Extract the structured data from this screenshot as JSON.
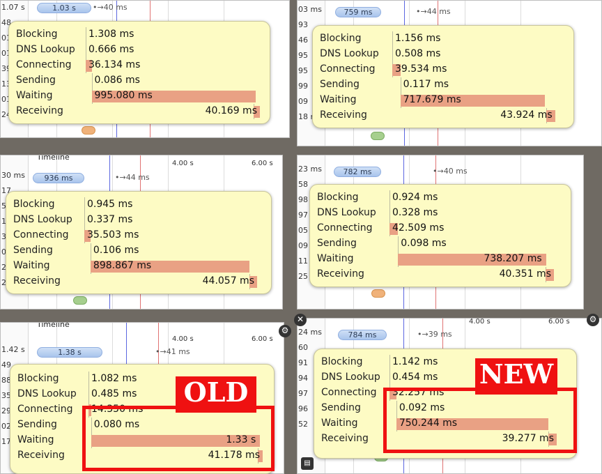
{
  "colors": {
    "tooltip_bg": "#fdfbc4",
    "bar": "#e9a184",
    "annotation": "#ef1111",
    "blue_marker": "#5c67e0",
    "red_marker": "#e07373"
  },
  "icons": [
    "close-icon",
    "gear-icon",
    "toolbar-icon"
  ],
  "panels": [
    {
      "row_labels": [
        "1.07 s",
        "48",
        "01",
        "01",
        "39",
        "13",
        "01",
        "24 ms"
      ],
      "pill": "1.03 s",
      "arrow": "40 ms",
      "ticks": [],
      "timeline": "",
      "rows": [
        {
          "label": "Blocking",
          "value": "1.308 ms",
          "bar": 0.0,
          "start": 0.0
        },
        {
          "label": "DNS Lookup",
          "value": "0.666 ms",
          "bar": 0.0,
          "start": 0.0
        },
        {
          "label": "Connecting",
          "value": "36.134 ms",
          "bar": 0.034,
          "start": 0.0
        },
        {
          "label": "Sending",
          "value": "0.086 ms",
          "bar": 0.0,
          "start": 0.034
        },
        {
          "label": "Waiting",
          "value": "995.080 ms",
          "bar": 0.94,
          "start": 0.034
        },
        {
          "label": "Receiving",
          "value": "40.169 ms",
          "bar": 0.038,
          "start": 0.962
        }
      ]
    },
    {
      "row_labels": [
        "03 ms",
        "93",
        "46",
        "95",
        "95",
        "99",
        "09",
        "18 ms"
      ],
      "pill": "759 ms",
      "arrow": "44 ms",
      "ticks": [],
      "timeline": "",
      "rows": [
        {
          "label": "Blocking",
          "value": "1.156 ms",
          "bar": 0.0,
          "start": 0.0
        },
        {
          "label": "DNS Lookup",
          "value": "0.508 ms",
          "bar": 0.0,
          "start": 0.0
        },
        {
          "label": "Connecting",
          "value": "39.534 ms",
          "bar": 0.049,
          "start": 0.0
        },
        {
          "label": "Sending",
          "value": "0.117 ms",
          "bar": 0.0,
          "start": 0.049
        },
        {
          "label": "Waiting",
          "value": "717.679 ms",
          "bar": 0.88,
          "start": 0.049
        },
        {
          "label": "Receiving",
          "value": "43.924 ms",
          "bar": 0.055,
          "start": 0.935
        }
      ]
    },
    {
      "row_labels": [
        "30 ms",
        "17",
        "56",
        "14",
        "34",
        "06",
        "24",
        "23 ms"
      ],
      "pill": "936 ms",
      "arrow": "44 ms",
      "ticks": [
        "4.00 s",
        "6.00 s"
      ],
      "timeline": "Timeline",
      "rows": [
        {
          "label": "Blocking",
          "value": "0.945 ms",
          "bar": 0.0,
          "start": 0.0
        },
        {
          "label": "DNS Lookup",
          "value": "0.337 ms",
          "bar": 0.0,
          "start": 0.0
        },
        {
          "label": "Connecting",
          "value": "35.503 ms",
          "bar": 0.036,
          "start": 0.0
        },
        {
          "label": "Sending",
          "value": "0.106 ms",
          "bar": 0.0,
          "start": 0.036
        },
        {
          "label": "Waiting",
          "value": "898.867 ms",
          "bar": 0.92,
          "start": 0.036
        },
        {
          "label": "Receiving",
          "value": "44.057 ms",
          "bar": 0.044,
          "start": 0.956
        }
      ]
    },
    {
      "row_labels": [
        "23 ms",
        "58",
        "98",
        "97",
        "05",
        "09",
        "11",
        "25 ms"
      ],
      "pill": "782 ms",
      "arrow": "40 ms",
      "ticks": [],
      "timeline": "",
      "rows": [
        {
          "label": "Blocking",
          "value": "0.924 ms",
          "bar": 0.0,
          "start": 0.0
        },
        {
          "label": "DNS Lookup",
          "value": "0.328 ms",
          "bar": 0.0,
          "start": 0.0
        },
        {
          "label": "Connecting",
          "value": "42.509 ms",
          "bar": 0.052,
          "start": 0.0
        },
        {
          "label": "Sending",
          "value": "0.098 ms",
          "bar": 0.0,
          "start": 0.052
        },
        {
          "label": "Waiting",
          "value": "738.207 ms",
          "bar": 0.9,
          "start": 0.052
        },
        {
          "label": "Receiving",
          "value": "40.351 ms",
          "bar": 0.05,
          "start": 0.95
        }
      ]
    },
    {
      "row_labels": [
        "1.42 s",
        "49",
        "88",
        "35",
        "29",
        "02",
        "17"
      ],
      "pill": "1.38 s",
      "arrow": "41 ms",
      "ticks": [
        "4.00 s",
        "6.00 s"
      ],
      "timeline": "Timeline",
      "annotation": "OLD",
      "rows": [
        {
          "label": "Blocking",
          "value": "1.082 ms",
          "bar": 0.0,
          "start": 0.0
        },
        {
          "label": "DNS Lookup",
          "value": "0.485 ms",
          "bar": 0.0,
          "start": 0.0
        },
        {
          "label": "Connecting",
          "value": "14.350 ms",
          "bar": 0.015,
          "start": 0.0
        },
        {
          "label": "Sending",
          "value": "0.080 ms",
          "bar": 0.0,
          "start": 0.015
        },
        {
          "label": "Waiting",
          "value": "1.33 s",
          "bar": 0.97,
          "start": 0.015
        },
        {
          "label": "Receiving",
          "value": "41.178 ms",
          "bar": 0.03,
          "start": 0.97
        }
      ]
    },
    {
      "row_labels": [
        "24 ms",
        "60",
        "91",
        "94",
        "97",
        "96",
        "52"
      ],
      "pill": "784 ms",
      "arrow": "39 ms",
      "ticks": [
        "4.00 s",
        "6.00 s"
      ],
      "timeline": "",
      "annotation": "NEW",
      "rows": [
        {
          "label": "Blocking",
          "value": "1.142 ms",
          "bar": 0.0,
          "start": 0.0
        },
        {
          "label": "DNS Lookup",
          "value": "0.454 ms",
          "bar": 0.0,
          "start": 0.0
        },
        {
          "label": "Connecting",
          "value": "32.257 ms",
          "bar": 0.041,
          "start": 0.0
        },
        {
          "label": "Sending",
          "value": "0.092 ms",
          "bar": 0.0,
          "start": 0.041
        },
        {
          "label": "Waiting",
          "value": "750.244 ms",
          "bar": 0.91,
          "start": 0.041
        },
        {
          "label": "Receiving",
          "value": "39.277 ms",
          "bar": 0.05,
          "start": 0.95
        }
      ]
    }
  ]
}
